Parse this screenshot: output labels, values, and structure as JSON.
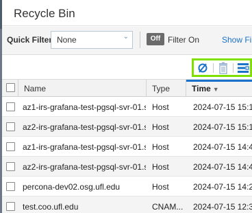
{
  "dialog": {
    "title": "Recycle Bin"
  },
  "filter_bar": {
    "quick_filter_label": "Quick Filter",
    "quick_filter_value": "None",
    "toggle_label": "Off",
    "filter_on_label": "Filter On",
    "show_filter_label": "Show Filt"
  },
  "toolbar": {
    "icons": [
      "clear-filter-icon",
      "trash-icon",
      "columns-icon"
    ],
    "highlight_color": "#7fe000"
  },
  "grid": {
    "columns": [
      {
        "label": "Name"
      },
      {
        "label": "Type"
      },
      {
        "label": "Time",
        "sorted": "descending"
      }
    ],
    "rows": [
      {
        "name": "az1-irs-grafana-test-pgsql-svr-01.s...",
        "type": "Host",
        "time": "2024-07-15 15:1..."
      },
      {
        "name": "az2-irs-grafana-test-pgsql-svr-01.s...",
        "type": "Host",
        "time": "2024-07-15 15:1..."
      },
      {
        "name": "az1-irs-grafana-test-pgsql-svr-01.s...",
        "type": "Host",
        "time": "2024-07-15 14:4..."
      },
      {
        "name": "az2-irs-grafana-test-pgsql-svr-01.s...",
        "type": "Host",
        "time": "2024-07-15 14:4..."
      },
      {
        "name": "percona-dev02.osg.ufl.edu",
        "type": "Host",
        "time": "2024-07-15 14:2..."
      },
      {
        "name": "test.coo.ufl.edu",
        "type": "CNAM...",
        "time": "2024-07-15 12:3..."
      }
    ]
  },
  "colors": {
    "accent": "#1a73c9",
    "toolbar_highlight": "#7fe000"
  }
}
